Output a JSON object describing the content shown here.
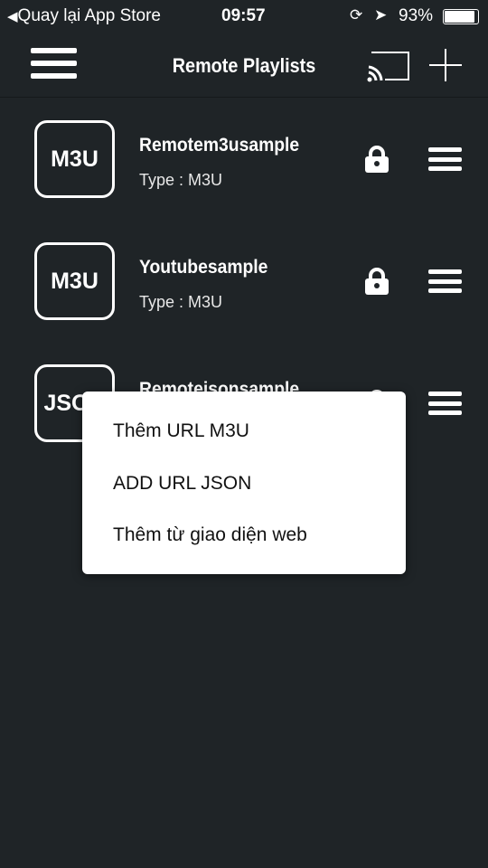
{
  "status_bar": {
    "back": "Quay lại App Store",
    "time": "09:57",
    "battery": "93%"
  },
  "header": {
    "title": "Remote Playlists",
    "menu_icon": "hamburger-icon",
    "cast_icon": "cast-icon",
    "add_icon": "plus-icon"
  },
  "playlists": [
    {
      "badge": "M3U",
      "name": "Remotem3usample",
      "type": "Type : M3U"
    },
    {
      "badge": "M3U",
      "name": "Youtubesample",
      "type": "Type : M3U"
    },
    {
      "badge": "JSON",
      "name": "Remotejsonsample",
      "type": ""
    }
  ],
  "popup_menu": {
    "items": [
      "Thêm URL M3U",
      "ADD URL JSON",
      "Thêm từ giao diện web"
    ]
  }
}
